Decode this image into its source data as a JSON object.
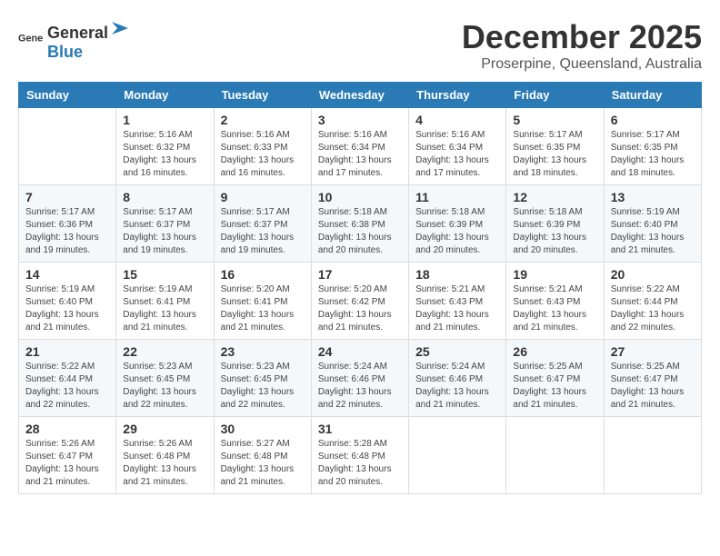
{
  "logo": {
    "general": "General",
    "blue": "Blue"
  },
  "title": {
    "month": "December 2025",
    "location": "Proserpine, Queensland, Australia"
  },
  "days_header": [
    "Sunday",
    "Monday",
    "Tuesday",
    "Wednesday",
    "Thursday",
    "Friday",
    "Saturday"
  ],
  "weeks": [
    [
      {
        "day": "",
        "sunrise": "",
        "sunset": "",
        "daylight": ""
      },
      {
        "day": "1",
        "sunrise": "Sunrise: 5:16 AM",
        "sunset": "Sunset: 6:32 PM",
        "daylight": "Daylight: 13 hours and 16 minutes."
      },
      {
        "day": "2",
        "sunrise": "Sunrise: 5:16 AM",
        "sunset": "Sunset: 6:33 PM",
        "daylight": "Daylight: 13 hours and 16 minutes."
      },
      {
        "day": "3",
        "sunrise": "Sunrise: 5:16 AM",
        "sunset": "Sunset: 6:34 PM",
        "daylight": "Daylight: 13 hours and 17 minutes."
      },
      {
        "day": "4",
        "sunrise": "Sunrise: 5:16 AM",
        "sunset": "Sunset: 6:34 PM",
        "daylight": "Daylight: 13 hours and 17 minutes."
      },
      {
        "day": "5",
        "sunrise": "Sunrise: 5:17 AM",
        "sunset": "Sunset: 6:35 PM",
        "daylight": "Daylight: 13 hours and 18 minutes."
      },
      {
        "day": "6",
        "sunrise": "Sunrise: 5:17 AM",
        "sunset": "Sunset: 6:35 PM",
        "daylight": "Daylight: 13 hours and 18 minutes."
      }
    ],
    [
      {
        "day": "7",
        "sunrise": "Sunrise: 5:17 AM",
        "sunset": "Sunset: 6:36 PM",
        "daylight": "Daylight: 13 hours and 19 minutes."
      },
      {
        "day": "8",
        "sunrise": "Sunrise: 5:17 AM",
        "sunset": "Sunset: 6:37 PM",
        "daylight": "Daylight: 13 hours and 19 minutes."
      },
      {
        "day": "9",
        "sunrise": "Sunrise: 5:17 AM",
        "sunset": "Sunset: 6:37 PM",
        "daylight": "Daylight: 13 hours and 19 minutes."
      },
      {
        "day": "10",
        "sunrise": "Sunrise: 5:18 AM",
        "sunset": "Sunset: 6:38 PM",
        "daylight": "Daylight: 13 hours and 20 minutes."
      },
      {
        "day": "11",
        "sunrise": "Sunrise: 5:18 AM",
        "sunset": "Sunset: 6:39 PM",
        "daylight": "Daylight: 13 hours and 20 minutes."
      },
      {
        "day": "12",
        "sunrise": "Sunrise: 5:18 AM",
        "sunset": "Sunset: 6:39 PM",
        "daylight": "Daylight: 13 hours and 20 minutes."
      },
      {
        "day": "13",
        "sunrise": "Sunrise: 5:19 AM",
        "sunset": "Sunset: 6:40 PM",
        "daylight": "Daylight: 13 hours and 21 minutes."
      }
    ],
    [
      {
        "day": "14",
        "sunrise": "Sunrise: 5:19 AM",
        "sunset": "Sunset: 6:40 PM",
        "daylight": "Daylight: 13 hours and 21 minutes."
      },
      {
        "day": "15",
        "sunrise": "Sunrise: 5:19 AM",
        "sunset": "Sunset: 6:41 PM",
        "daylight": "Daylight: 13 hours and 21 minutes."
      },
      {
        "day": "16",
        "sunrise": "Sunrise: 5:20 AM",
        "sunset": "Sunset: 6:41 PM",
        "daylight": "Daylight: 13 hours and 21 minutes."
      },
      {
        "day": "17",
        "sunrise": "Sunrise: 5:20 AM",
        "sunset": "Sunset: 6:42 PM",
        "daylight": "Daylight: 13 hours and 21 minutes."
      },
      {
        "day": "18",
        "sunrise": "Sunrise: 5:21 AM",
        "sunset": "Sunset: 6:43 PM",
        "daylight": "Daylight: 13 hours and 21 minutes."
      },
      {
        "day": "19",
        "sunrise": "Sunrise: 5:21 AM",
        "sunset": "Sunset: 6:43 PM",
        "daylight": "Daylight: 13 hours and 21 minutes."
      },
      {
        "day": "20",
        "sunrise": "Sunrise: 5:22 AM",
        "sunset": "Sunset: 6:44 PM",
        "daylight": "Daylight: 13 hours and 22 minutes."
      }
    ],
    [
      {
        "day": "21",
        "sunrise": "Sunrise: 5:22 AM",
        "sunset": "Sunset: 6:44 PM",
        "daylight": "Daylight: 13 hours and 22 minutes."
      },
      {
        "day": "22",
        "sunrise": "Sunrise: 5:23 AM",
        "sunset": "Sunset: 6:45 PM",
        "daylight": "Daylight: 13 hours and 22 minutes."
      },
      {
        "day": "23",
        "sunrise": "Sunrise: 5:23 AM",
        "sunset": "Sunset: 6:45 PM",
        "daylight": "Daylight: 13 hours and 22 minutes."
      },
      {
        "day": "24",
        "sunrise": "Sunrise: 5:24 AM",
        "sunset": "Sunset: 6:46 PM",
        "daylight": "Daylight: 13 hours and 22 minutes."
      },
      {
        "day": "25",
        "sunrise": "Sunrise: 5:24 AM",
        "sunset": "Sunset: 6:46 PM",
        "daylight": "Daylight: 13 hours and 21 minutes."
      },
      {
        "day": "26",
        "sunrise": "Sunrise: 5:25 AM",
        "sunset": "Sunset: 6:47 PM",
        "daylight": "Daylight: 13 hours and 21 minutes."
      },
      {
        "day": "27",
        "sunrise": "Sunrise: 5:25 AM",
        "sunset": "Sunset: 6:47 PM",
        "daylight": "Daylight: 13 hours and 21 minutes."
      }
    ],
    [
      {
        "day": "28",
        "sunrise": "Sunrise: 5:26 AM",
        "sunset": "Sunset: 6:47 PM",
        "daylight": "Daylight: 13 hours and 21 minutes."
      },
      {
        "day": "29",
        "sunrise": "Sunrise: 5:26 AM",
        "sunset": "Sunset: 6:48 PM",
        "daylight": "Daylight: 13 hours and 21 minutes."
      },
      {
        "day": "30",
        "sunrise": "Sunrise: 5:27 AM",
        "sunset": "Sunset: 6:48 PM",
        "daylight": "Daylight: 13 hours and 21 minutes."
      },
      {
        "day": "31",
        "sunrise": "Sunrise: 5:28 AM",
        "sunset": "Sunset: 6:48 PM",
        "daylight": "Daylight: 13 hours and 20 minutes."
      },
      {
        "day": "",
        "sunrise": "",
        "sunset": "",
        "daylight": ""
      },
      {
        "day": "",
        "sunrise": "",
        "sunset": "",
        "daylight": ""
      },
      {
        "day": "",
        "sunrise": "",
        "sunset": "",
        "daylight": ""
      }
    ]
  ]
}
